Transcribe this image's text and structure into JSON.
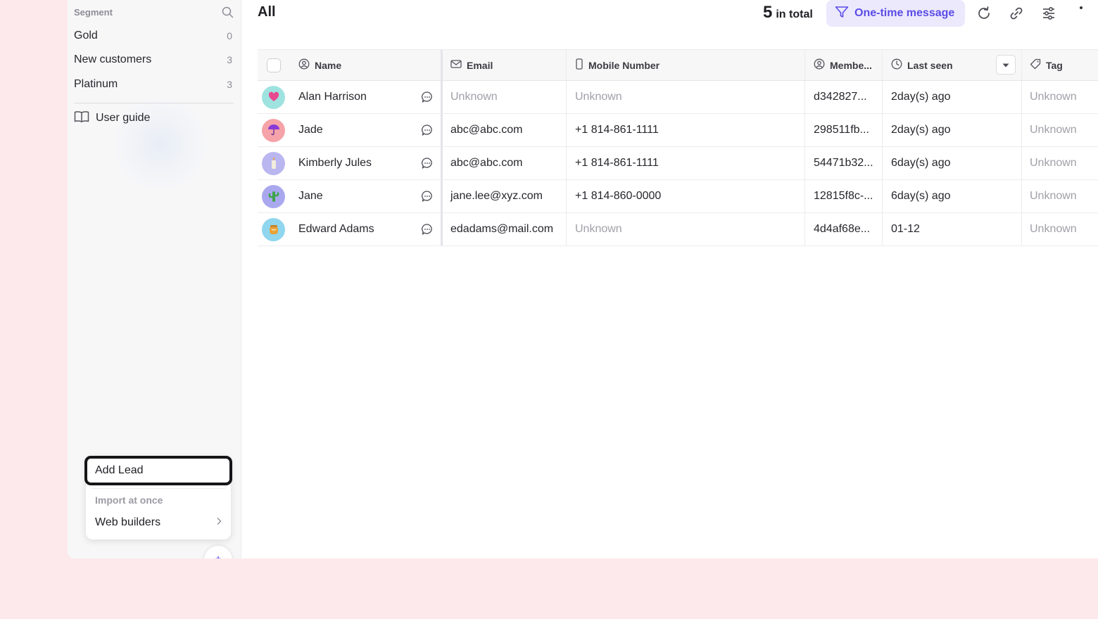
{
  "sidebar": {
    "segment_title": "Segment",
    "segments": [
      {
        "label": "Gold",
        "count": "0"
      },
      {
        "label": "New customers",
        "count": "3"
      },
      {
        "label": "Platinum",
        "count": "3"
      }
    ],
    "user_guide": "User guide"
  },
  "menu": {
    "add_lead": "Add Lead",
    "import_at_once": "Import at once",
    "web_builders": "Web builders"
  },
  "fab_label": "+",
  "main": {
    "title": "All",
    "total_count": "5",
    "total_label": "in total",
    "one_time_message": "One-time message"
  },
  "table": {
    "columns": [
      "Name",
      "Email",
      "Mobile Number",
      "Membe...",
      "Last seen",
      "Tag"
    ],
    "rows": [
      {
        "name": "Alan Harrison",
        "email": "Unknown",
        "mobile": "Unknown",
        "member": "d342827...",
        "last_seen": "2day(s) ago",
        "tag": "Unknown",
        "avatar_bg": "#9fe3e0"
      },
      {
        "name": "Jade",
        "email": "abc@abc.com",
        "mobile": "+1 814-861-1111",
        "member": "298511fb...",
        "last_seen": "2day(s) ago",
        "tag": "Unknown",
        "avatar_bg": "#f5a3a8"
      },
      {
        "name": "Kimberly Jules",
        "email": "abc@abc.com",
        "mobile": "+1 814-861-1111",
        "member": "54471b32...",
        "last_seen": "6day(s) ago",
        "tag": "Unknown",
        "avatar_bg": "#b9b6f0"
      },
      {
        "name": "Jane",
        "email": "jane.lee@xyz.com",
        "mobile": "+1 814-860-0000",
        "member": "12815f8c-...",
        "last_seen": "6day(s) ago",
        "tag": "Unknown",
        "avatar_bg": "#a9a8ef"
      },
      {
        "name": "Edward Adams",
        "email": "edadams@mail.com",
        "mobile": "Unknown",
        "member": "4d4af68e...",
        "last_seen": "01-12",
        "tag": "Unknown",
        "avatar_bg": "#8fd6ee"
      }
    ]
  },
  "colors": {
    "accent": "#5b4ce6",
    "accent_bg": "#ece9fd",
    "page_bg": "#fde9ec"
  }
}
